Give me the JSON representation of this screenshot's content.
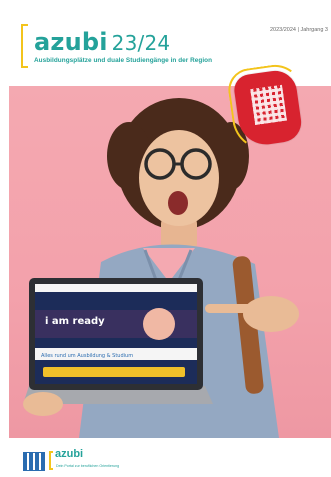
{
  "masthead": {
    "brand": "azubi",
    "year": "23/24",
    "subtitle": "Ausbildungsplätze und duale Studiengänge in der Region",
    "issue": "2023/2024 | Jahrgang 3"
  },
  "colors": {
    "accent": "#24a29a",
    "bracket": "#f3c41c",
    "background": "#f4a9b1",
    "badge": "#d8232f"
  },
  "screen": {
    "headline": "i am ready",
    "banner": "Alles rund um Ausbildung & Studium",
    "nav": [
      "Home",
      "Berufe",
      "Betriebe",
      "Studium",
      "Kontakt"
    ]
  },
  "footer": {
    "brand": "azubi",
    "tagline": "Dein Portal zur beruflichen Orientierung",
    "icon": "qr-code-icon"
  }
}
